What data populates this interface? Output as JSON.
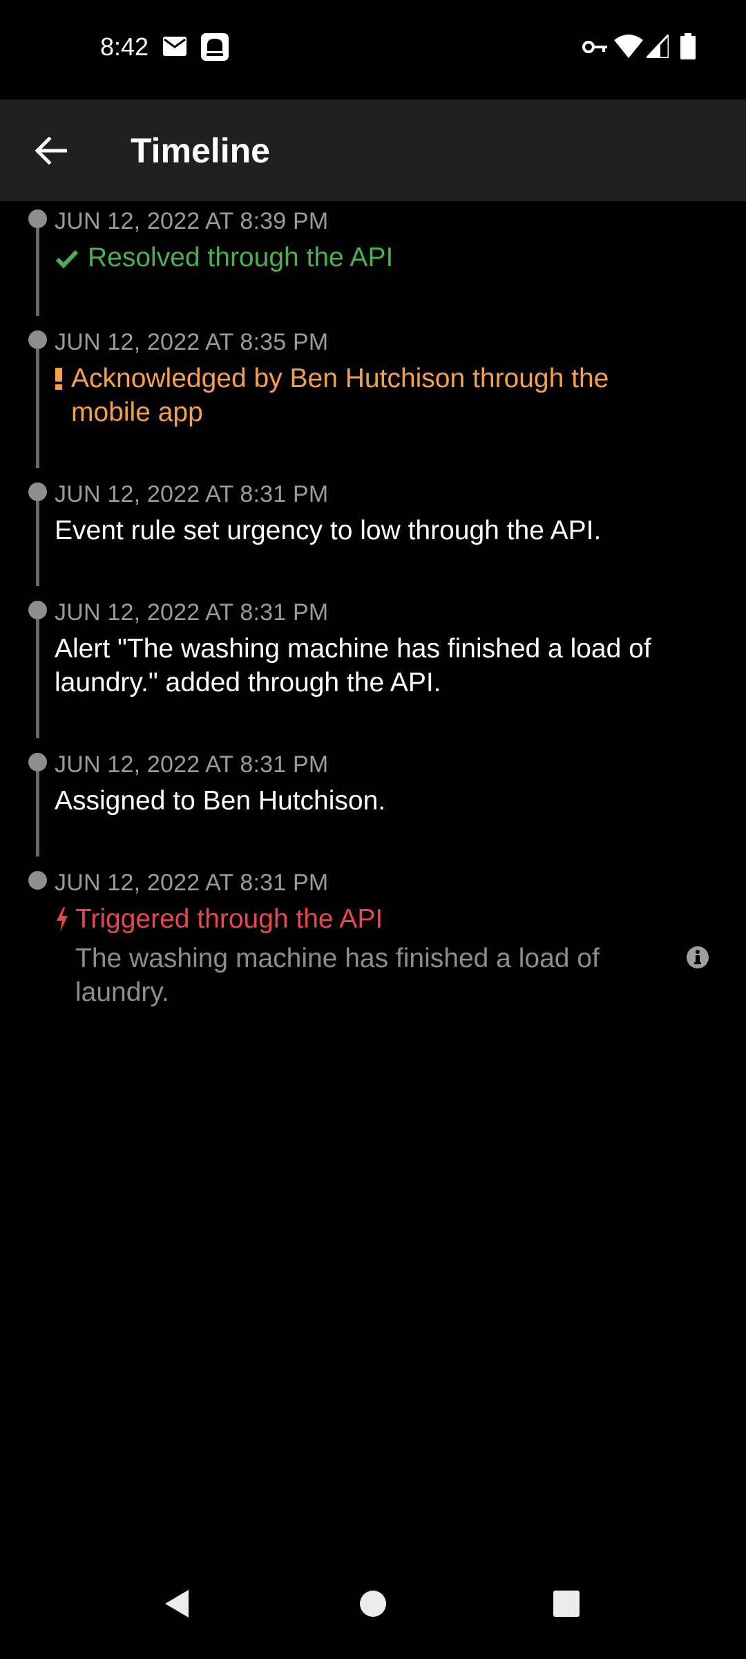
{
  "status_bar": {
    "time": "8:42",
    "left_icons": [
      "mail-icon",
      "notification-app-icon"
    ],
    "right_icons": [
      "vpn-key-icon",
      "wifi-icon",
      "signal-icon",
      "battery-icon"
    ]
  },
  "app_bar": {
    "title": "Timeline",
    "back_icon": "arrow-back-icon"
  },
  "timeline": {
    "entries": [
      {
        "date": "JUN 12, 2022 AT 8:39 PM",
        "text": "Resolved through the API",
        "icon": "check-icon",
        "color": "#4caf50"
      },
      {
        "date": "JUN 12, 2022 AT 8:35 PM",
        "text": "Acknowledged by Ben Hutchison through the mobile app",
        "icon": "exclamation-icon",
        "color": "#f5a04b"
      },
      {
        "date": "JUN 12, 2022 AT 8:31 PM",
        "text": "Event rule set urgency to low through the API.",
        "color": "#ffffff"
      },
      {
        "date": "JUN 12, 2022 AT 8:31 PM",
        "text": "Alert \"The washing machine has finished a load of laundry.\" added through the API.",
        "color": "#ffffff"
      },
      {
        "date": "JUN 12, 2022 AT 8:31 PM",
        "text": "Assigned to Ben Hutchison.",
        "color": "#ffffff"
      },
      {
        "date": "JUN 12, 2022 AT 8:31 PM",
        "text": "Triggered through the API",
        "icon": "bolt-icon",
        "color": "#e8474c",
        "detail": "The washing machine has finished a load of laundry.",
        "detail_icon": "info-icon"
      }
    ]
  },
  "nav_bar": {
    "buttons": [
      "back-triangle-icon",
      "home-circle-icon",
      "recents-square-icon"
    ]
  }
}
